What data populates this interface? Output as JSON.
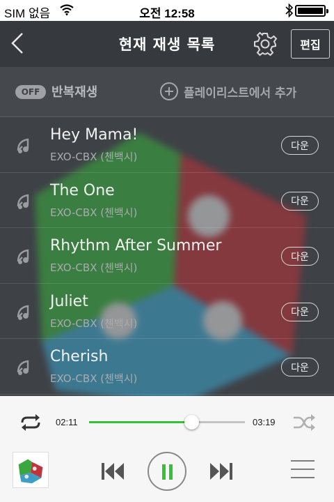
{
  "status_bar": {
    "carrier": "SIM 없음",
    "time": "오전 12:58"
  },
  "header": {
    "title": "현재 재생 목록",
    "edit_label": "편집"
  },
  "toolbar": {
    "repeat_toggle": "OFF",
    "repeat_label": "반복재생",
    "add_playlist_label": "플레이리스트에서 추가"
  },
  "tracks": [
    {
      "title": "Hey Mama!",
      "artist": "EXO-CBX (첸백시)",
      "download_label": "다운"
    },
    {
      "title": "The One",
      "artist": "EXO-CBX (첸백시)",
      "download_label": "다운"
    },
    {
      "title": "Rhythm After Summer",
      "artist": "EXO-CBX (첸백시)",
      "download_label": "다운"
    },
    {
      "title": "Juliet",
      "artist": "EXO-CBX (첸백시)",
      "download_label": "다운"
    },
    {
      "title": "Cherish",
      "artist": "EXO-CBX (첸백시)",
      "download_label": "다운"
    }
  ],
  "player": {
    "elapsed": "02:11",
    "total": "03:19",
    "progress": 0.657,
    "state": "playing"
  },
  "colors": {
    "accent": "#33c435",
    "main_background": "#3e4146",
    "header_background": "#36393e",
    "player_background": "#f6f6f6"
  },
  "icons": {
    "back": "chevron-left-icon",
    "settings": "gear-icon",
    "add": "plus-circle-icon",
    "track": "music-note-icon",
    "repeat": "repeat-icon",
    "shuffle": "shuffle-icon",
    "previous": "skip-previous-icon",
    "pause": "pause-icon",
    "next": "skip-next-icon",
    "menu": "hamburger-icon"
  }
}
